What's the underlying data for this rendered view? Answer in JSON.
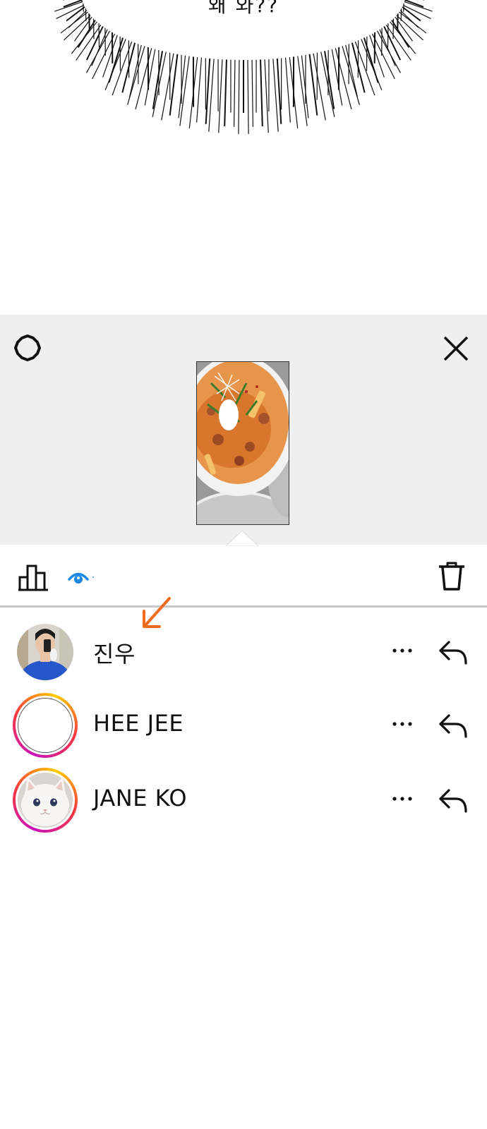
{
  "comic": {
    "speech_text": "왜 와??"
  },
  "story_viewer": {
    "thumbnail_alt": "food photo story preview"
  },
  "toolbar": {
    "insights_icon": "bar-chart-icon",
    "viewers_icon": "eye-icon",
    "viewer_count": "·",
    "delete_icon": "trash-icon"
  },
  "viewers": [
    {
      "name": "진우",
      "avatar": "photo-person",
      "has_story_ring": false
    },
    {
      "name": "HEE JEE",
      "avatar": "empty",
      "has_story_ring": true
    },
    {
      "name": "JANE KO",
      "avatar": "photo-cat",
      "has_story_ring": true
    }
  ],
  "colors": {
    "accent_blue": "#1e88e5",
    "annotation_orange": "#f26a1b",
    "sheet_bg": "#efefef"
  }
}
